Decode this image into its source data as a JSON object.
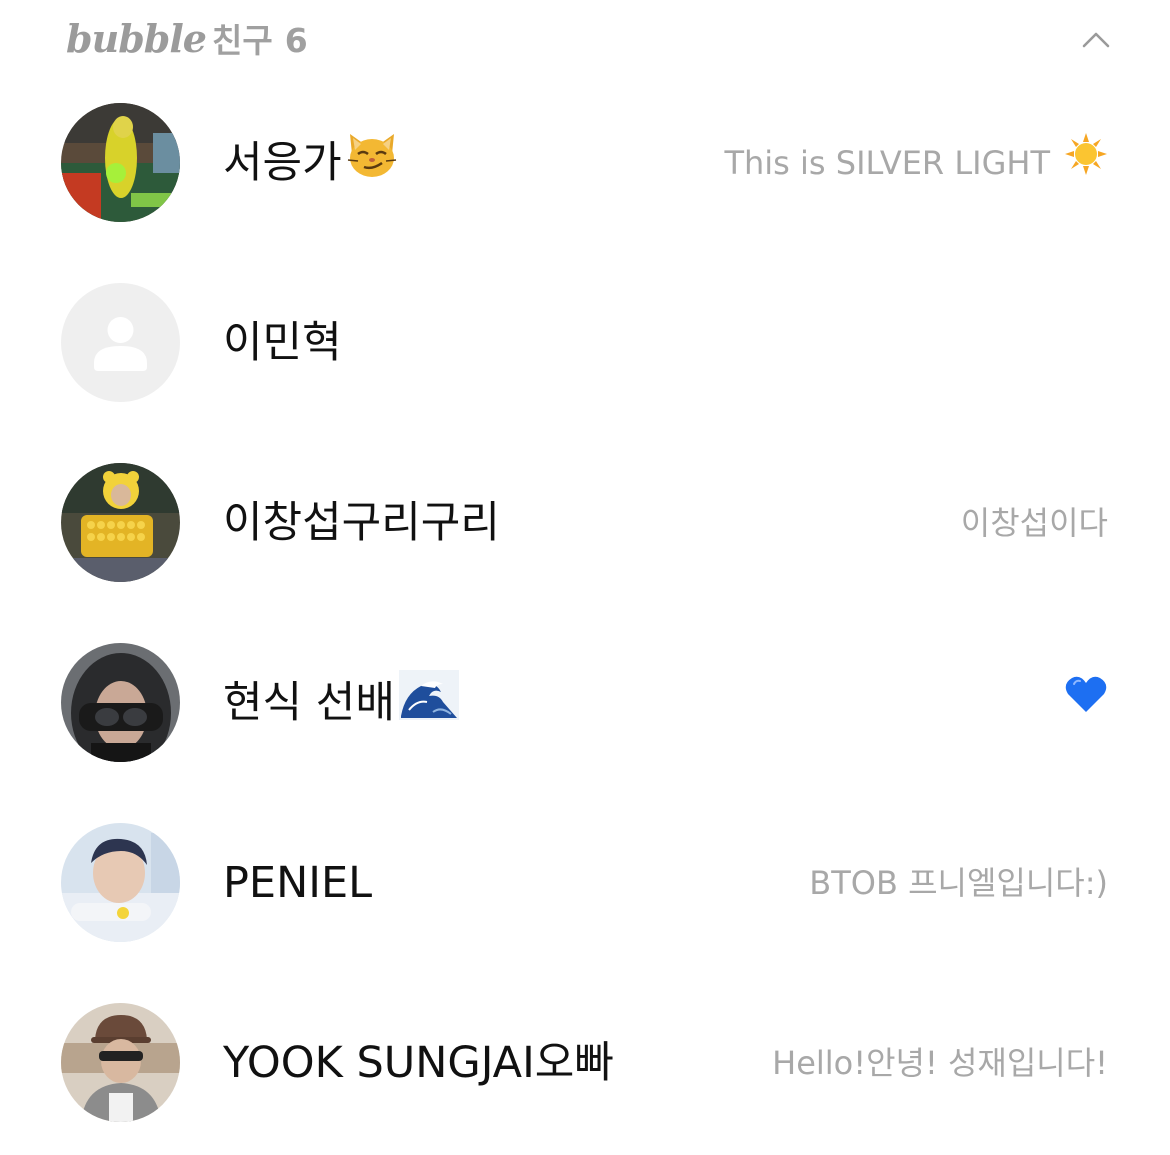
{
  "header": {
    "brand": "bubble",
    "section_label": "친구",
    "count": "6",
    "collapse_icon": "chevron-up-icon"
  },
  "friends": [
    {
      "name": "서응가",
      "name_emoji": "smirk-cat-emoji",
      "status": "This is SILVER LIGHT",
      "status_emoji": "sun-emoji",
      "avatar": "photo-avatar"
    },
    {
      "name": "이민혁",
      "status": "",
      "avatar": "default-person-avatar"
    },
    {
      "name": "이창섭구리구리",
      "status": "이창섭이다",
      "avatar": "photo-avatar"
    },
    {
      "name": "현식 선배",
      "name_emoji": "wave-emoji",
      "status": "",
      "status_emoji": "blue-heart-emoji",
      "avatar": "photo-avatar"
    },
    {
      "name": "PENIEL",
      "status": "BTOB 프니엘입니다:)",
      "avatar": "photo-avatar"
    },
    {
      "name": "YOOK SUNGJAI오빠",
      "status": "Hello!안녕! 성재입니다!",
      "avatar": "photo-avatar"
    }
  ],
  "colors": {
    "name_text": "#111111",
    "status_text": "#a8a8a8",
    "header_text": "#9b9b9b",
    "default_avatar_bg": "#efefef"
  }
}
